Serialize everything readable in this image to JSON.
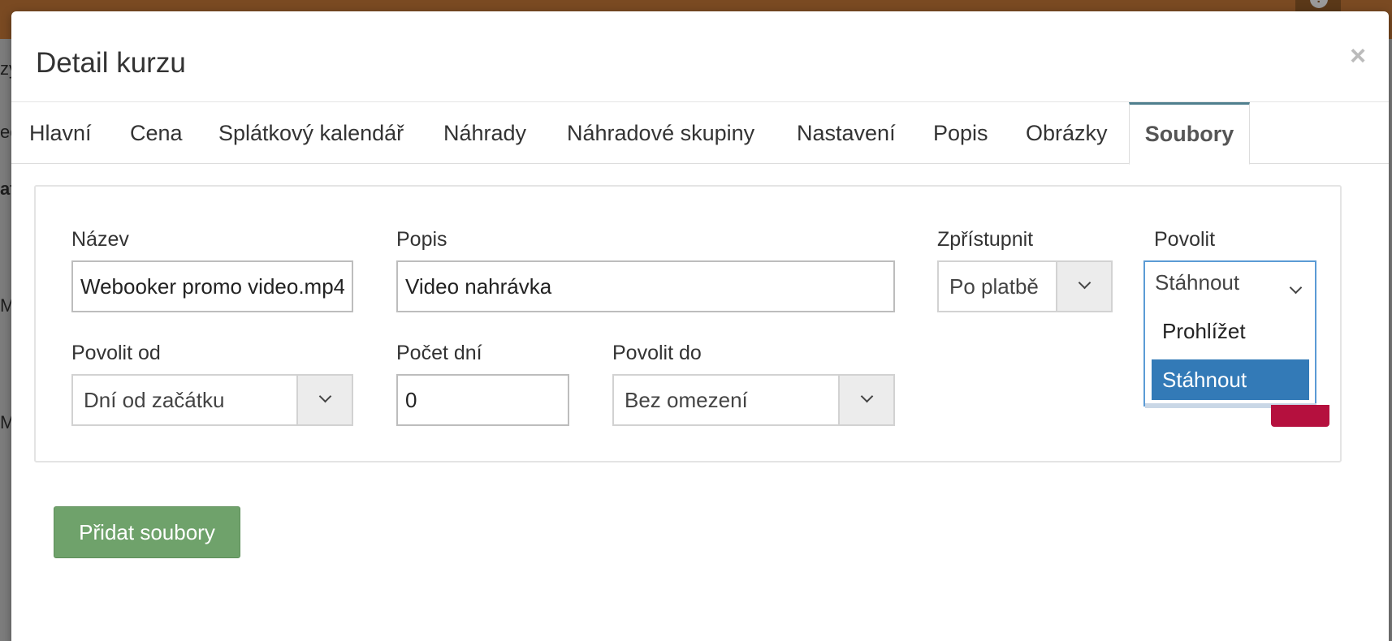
{
  "modal": {
    "title": "Detail kurzu",
    "close_label": "×"
  },
  "tabs": [
    {
      "label": "Hlavní"
    },
    {
      "label": "Cena"
    },
    {
      "label": "Splátkový kalendář"
    },
    {
      "label": "Náhrady"
    },
    {
      "label": "Náhradové skupiny"
    },
    {
      "label": "Nastavení"
    },
    {
      "label": "Popis"
    },
    {
      "label": "Obrázky"
    },
    {
      "label": "Soubory",
      "active": true
    }
  ],
  "file_row": {
    "name": {
      "label": "Název",
      "value": "Webooker promo video.mp4"
    },
    "description": {
      "label": "Popis",
      "value": "Video nahrávka"
    },
    "access": {
      "label": "Zpřístupnit",
      "value": "Po platbě"
    },
    "allow": {
      "label": "Povolit",
      "value": "Stáhnout",
      "options": [
        "Prohlížet",
        "Stáhnout"
      ],
      "selected": "Stáhnout"
    },
    "allow_from": {
      "label": "Povolit od",
      "value": "Dní od začátku"
    },
    "day_count": {
      "label": "Počet dní",
      "value": "0"
    },
    "allow_until": {
      "label": "Povolit do",
      "value": "Bez omezení"
    }
  },
  "actions": {
    "add_files_label": "Přidat soubory"
  },
  "background": {
    "snippets": [
      "zy",
      "ec",
      "at",
      "M",
      "M"
    ]
  },
  "colors": {
    "active_tab_border": "#4f7f8e",
    "add_button": "#6fa26b",
    "selected_option": "#337ab7",
    "delete_button": "#b5103e"
  }
}
